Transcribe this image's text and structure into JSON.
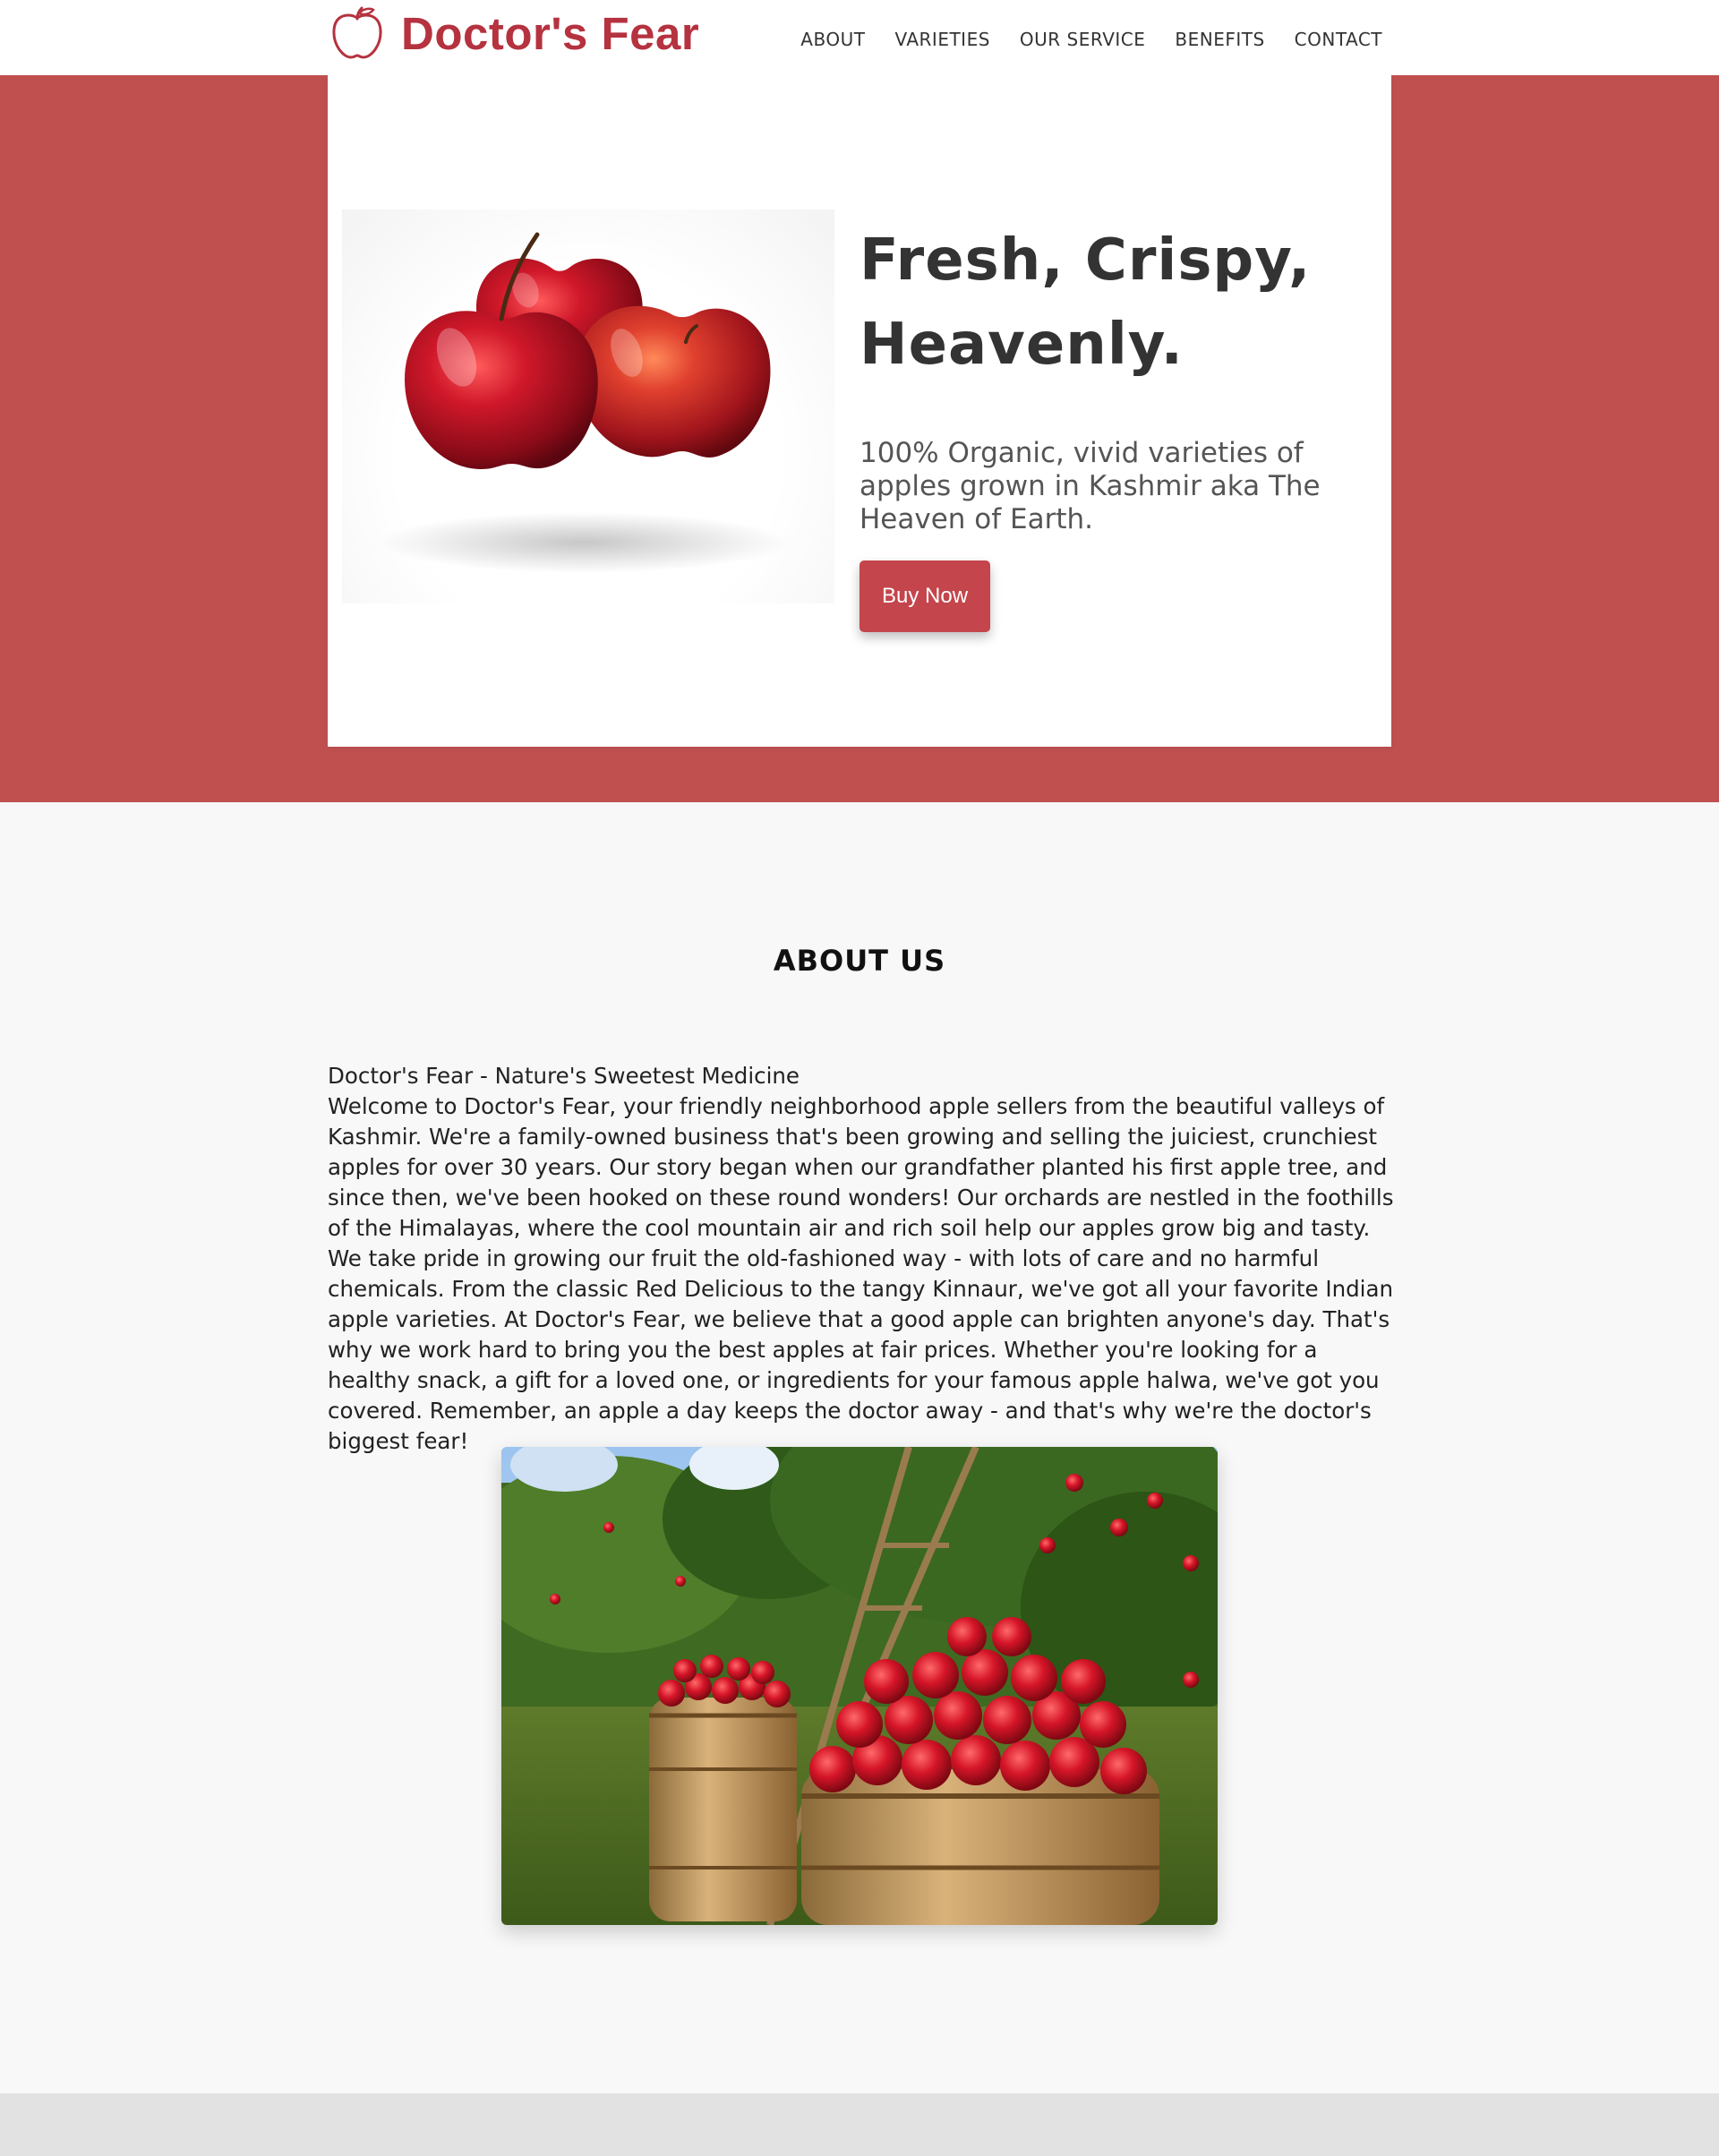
{
  "brand": {
    "name": "Doctor's Fear",
    "logo_icon": "apple-outline-icon",
    "color": "#b5323f"
  },
  "nav": {
    "items": [
      {
        "label": "ABOUT"
      },
      {
        "label": "VARIETIES"
      },
      {
        "label": "OUR SERVICE"
      },
      {
        "label": "BENEFITS"
      },
      {
        "label": "CONTACT"
      }
    ]
  },
  "hero": {
    "title_line1": "Fresh, Crispy,",
    "title_line2": "Heavenly.",
    "subtitle": "100% Organic, vivid varieties of apples grown in Kashmir aka The Heaven of Earth.",
    "button_label": "Buy Now",
    "image_subject": "three-red-apples",
    "band_color": "#c05050",
    "button_color": "#c4454b"
  },
  "about": {
    "title": "ABOUT US",
    "subtitle": "Doctor's Fear - Nature's Sweetest Medicine",
    "body": "Welcome to Doctor's Fear, your friendly neighborhood apple sellers from the beautiful valleys of Kashmir. We're a family-owned business that's been growing and selling the juiciest, crunchiest apples for over 30 years. Our story began when our grandfather planted his first apple tree, and since then, we've been hooked on these round wonders! Our orchards are nestled in the foothills of the Himalayas, where the cool mountain air and rich soil help our apples grow big and tasty. We take pride in growing our fruit the old-fashioned way - with lots of care and no harmful chemicals. From the classic Red Delicious to the tangy Kinnaur, we've got all your favorite Indian apple varieties. At Doctor's Fear, we believe that a good apple can brighten anyone's day. That's why we work hard to bring you the best apples at fair prices. Whether you're looking for a healthy snack, a gift for a loved one, or ingredients for your famous apple halwa, we've got you covered. Remember, an apple a day keeps the doctor away - and that's why we're the doctor's biggest fear!",
    "image_subject": "apple-barrels-in-orchard"
  }
}
